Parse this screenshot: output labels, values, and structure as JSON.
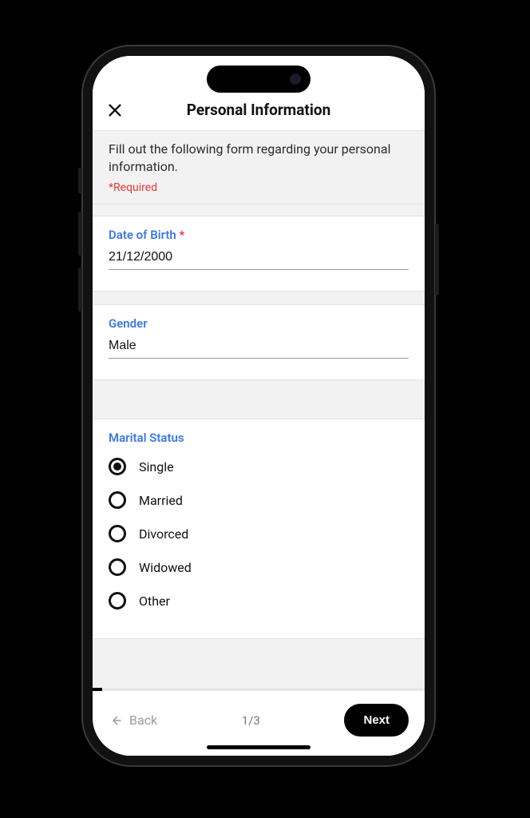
{
  "header": {
    "title": "Personal Information"
  },
  "intro": {
    "text": "Fill out the following form regarding your personal information.",
    "required_note": "*Required"
  },
  "fields": {
    "dob": {
      "label": "Date of Birth",
      "required_mark": "*",
      "value": "21/12/2000"
    },
    "gender": {
      "label": "Gender",
      "value": "Male"
    },
    "marital": {
      "label": "Marital Status",
      "options": [
        {
          "label": "Single",
          "selected": true
        },
        {
          "label": "Married",
          "selected": false
        },
        {
          "label": "Divorced",
          "selected": false
        },
        {
          "label": "Widowed",
          "selected": false
        },
        {
          "label": "Other",
          "selected": false
        }
      ]
    }
  },
  "footer": {
    "back_label": "Back",
    "page_indicator": "1/3",
    "next_label": "Next"
  }
}
